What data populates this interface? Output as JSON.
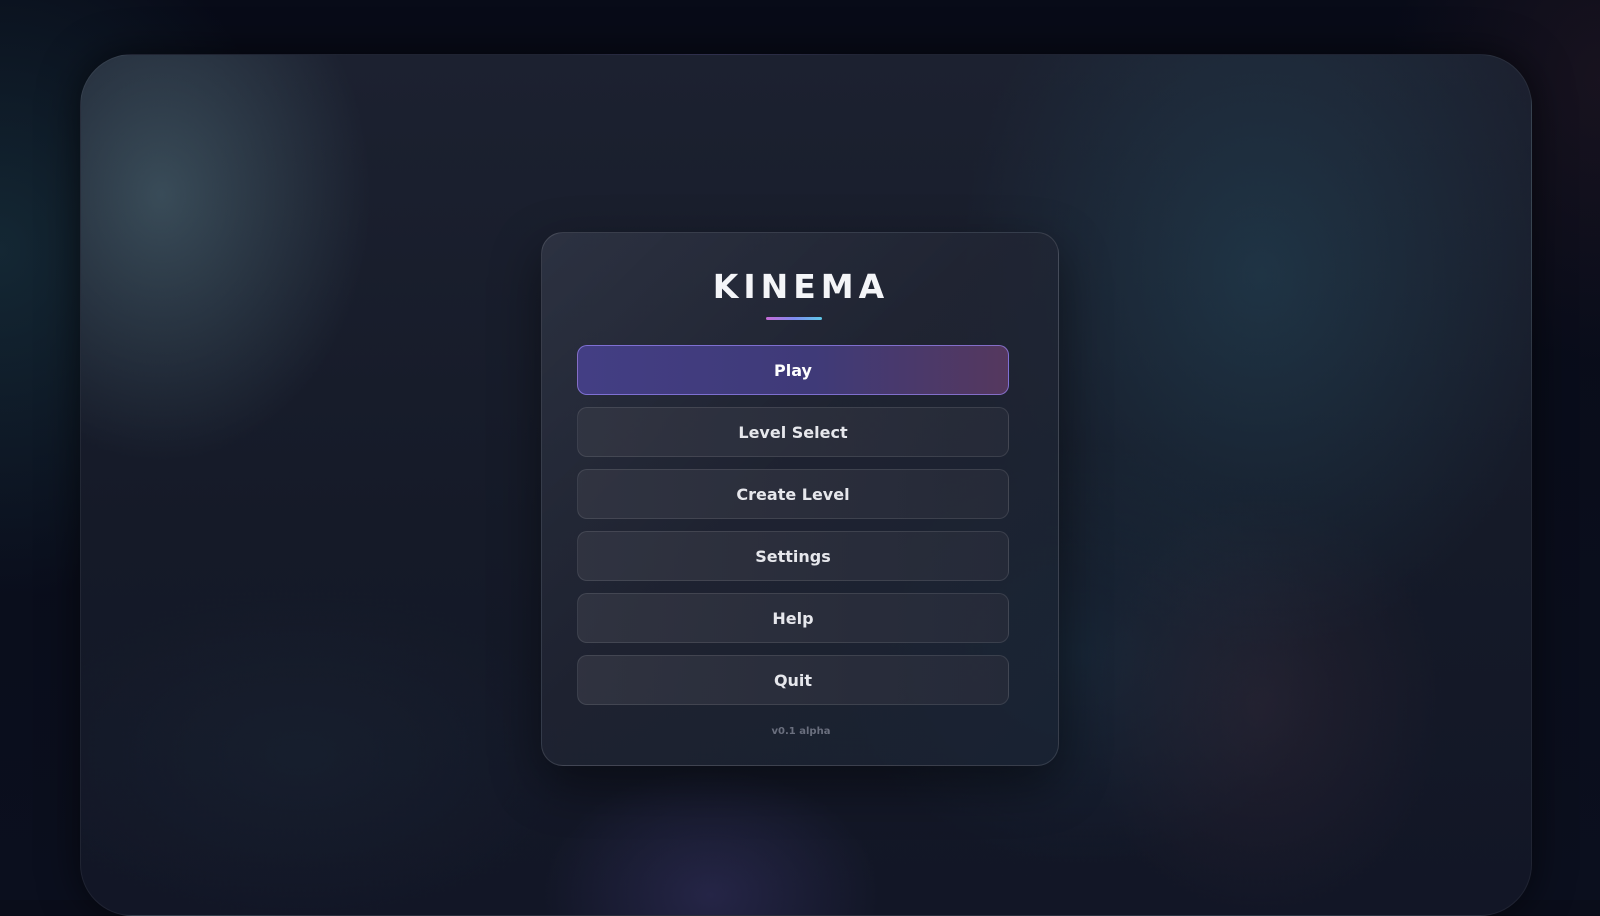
{
  "app": {
    "title": "KINEMA",
    "version": "v0.1 alpha",
    "accent_gradient": [
      "#c76ad6",
      "#7f8cf0",
      "#5ec8e8"
    ]
  },
  "menu": {
    "buttons": [
      {
        "label": "Play",
        "primary": true
      },
      {
        "label": "Level Select",
        "primary": false
      },
      {
        "label": "Create Level",
        "primary": false
      },
      {
        "label": "Settings",
        "primary": false
      },
      {
        "label": "Help",
        "primary": false
      },
      {
        "label": "Quit",
        "primary": false
      }
    ]
  }
}
